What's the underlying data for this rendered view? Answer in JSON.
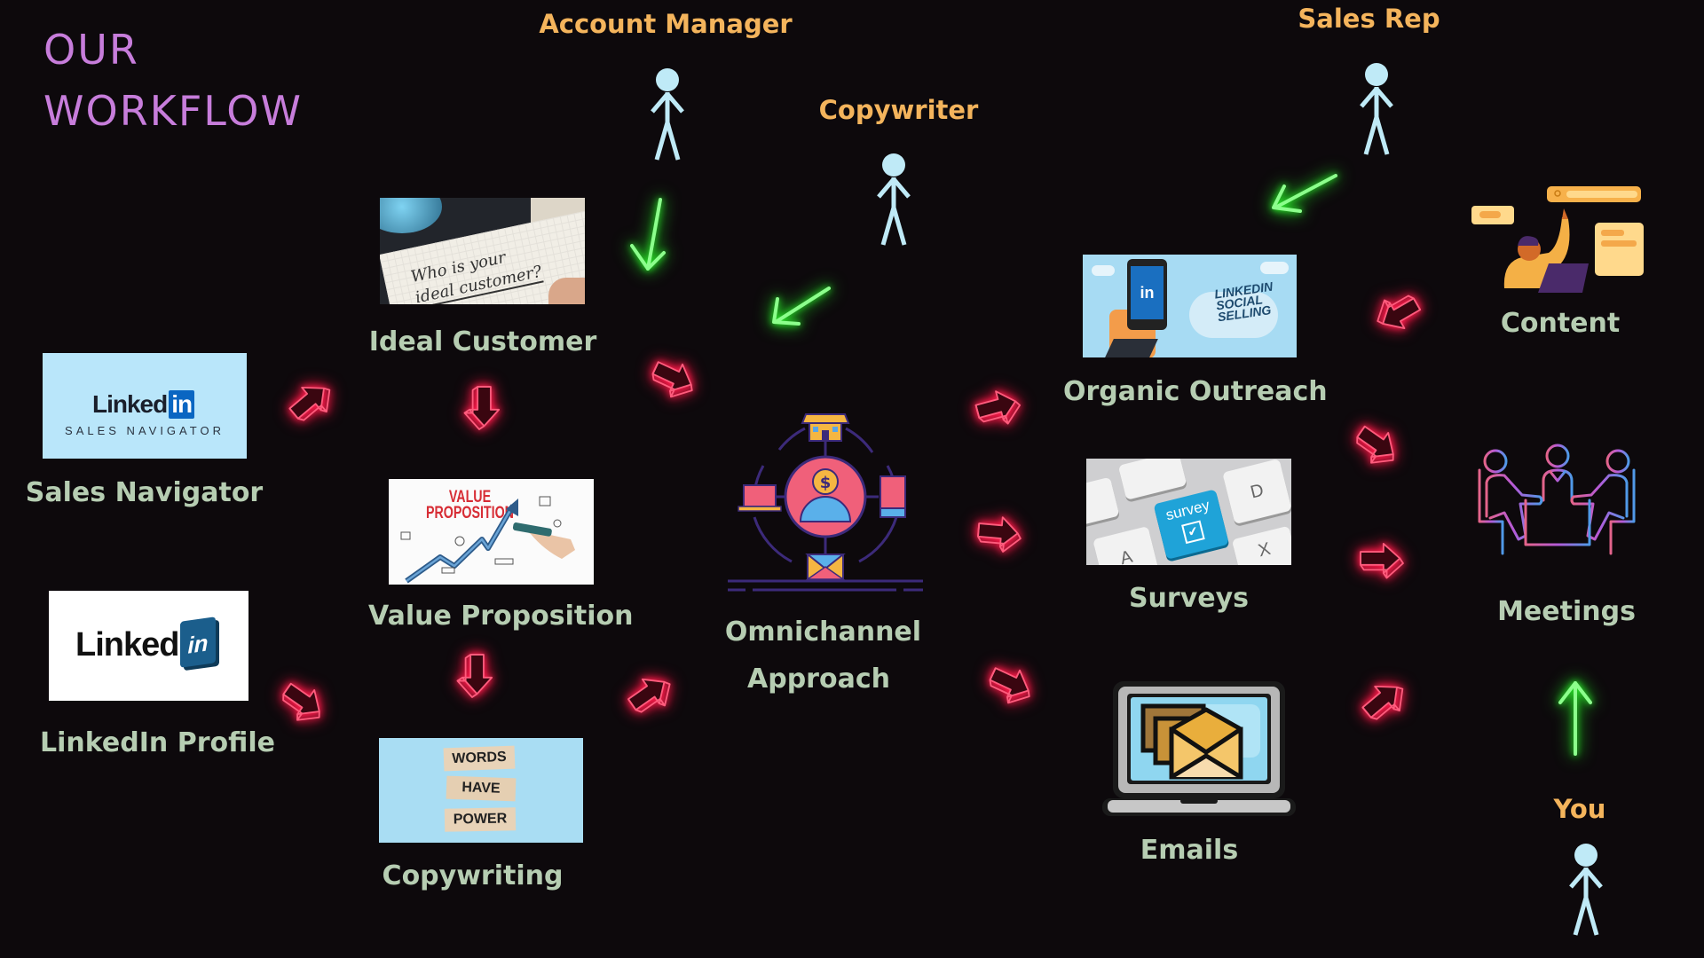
{
  "title": {
    "line1": "OUR",
    "line2": "WORKFLOW",
    "color": "#c77ddb"
  },
  "colors": {
    "background": "#0d090c",
    "label": "#b6cdb2",
    "role": "#f4b45c",
    "neon_red": "#ff2a55",
    "neon_green": "#39ff3a",
    "stick_figure": "#bfeaf7"
  },
  "roles": {
    "account_manager": "Account Manager",
    "copywriter": "Copywriter",
    "sales_rep": "Sales Rep",
    "you": "You"
  },
  "nodes": {
    "sales_navigator": {
      "label": "Sales Navigator",
      "image_text_brand": "Linked",
      "image_text_in": "in",
      "image_text_sub": "SALES NAVIGATOR"
    },
    "linkedin_profile": {
      "label": "LinkedIn Profile",
      "image_text_brand": "Linked",
      "image_text_in": "in"
    },
    "ideal_customer": {
      "label": "Ideal Customer",
      "image_text_line1": "Who is your",
      "image_text_line2": "ideal customer?"
    },
    "value_proposition": {
      "label": "Value Proposition",
      "image_text_line1": "VALUE",
      "image_text_line2": "PROPOSITION"
    },
    "copywriting": {
      "label": "Copywriting",
      "blocks": [
        "WORDS",
        "HAVE",
        "POWER"
      ]
    },
    "omnichannel": {
      "label_line1": "Omnichannel",
      "label_line2": "Approach",
      "center_symbol": "$"
    },
    "organic_outreach": {
      "label": "Organic Outreach",
      "image_text_in": "in",
      "image_text_lines": [
        "LINKEDIN",
        "SOCIAL",
        "SELLING"
      ]
    },
    "surveys": {
      "label": "Surveys",
      "key_text": "survey",
      "key_check": "✔",
      "other_keys": [
        "A",
        "D",
        "X"
      ]
    },
    "emails": {
      "label": "Emails"
    },
    "content": {
      "label": "Content"
    },
    "meetings": {
      "label": "Meetings"
    }
  }
}
